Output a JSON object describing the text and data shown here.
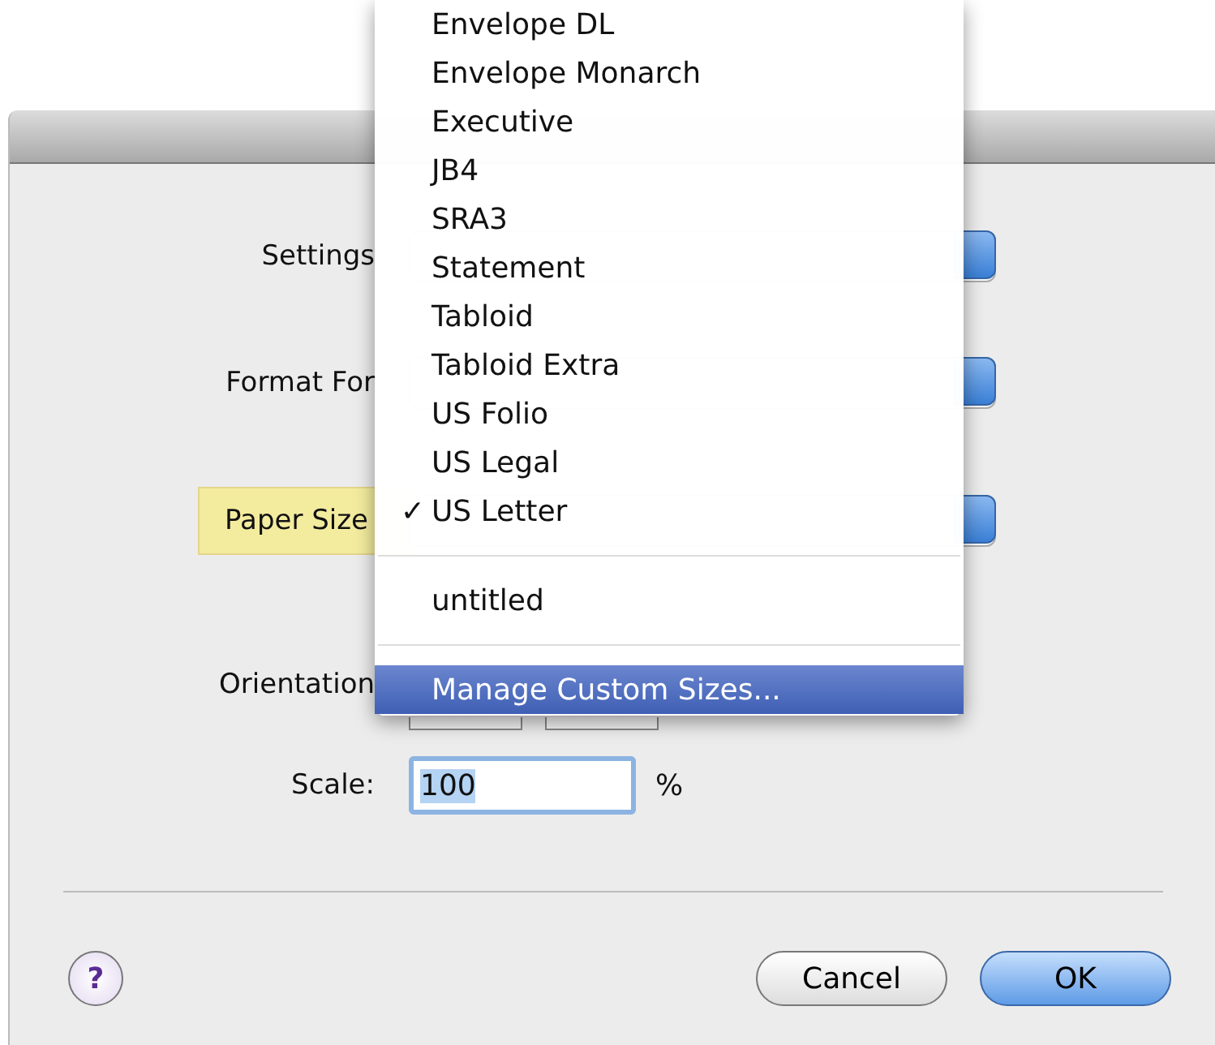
{
  "dialog": {
    "rows": [
      {
        "kind": "popup",
        "label": "Settings",
        "highlighted": false
      },
      {
        "kind": "popup",
        "label": "Format For",
        "highlighted": false
      },
      {
        "kind": "popup",
        "label": "Paper Size",
        "highlighted": true
      },
      {
        "kind": "orientation",
        "label": "Orientation",
        "highlighted": false
      },
      {
        "kind": "field",
        "label": "Scale:",
        "value": "100",
        "unit": "%",
        "highlighted": false
      }
    ],
    "help_button": "?",
    "buttons": [
      {
        "label": "Cancel",
        "default": false
      },
      {
        "label": "OK",
        "default": true
      }
    ]
  },
  "menu": {
    "check_mark": "✓",
    "items": [
      {
        "kind": "option",
        "label": "Envelope DL",
        "checked": false,
        "highlighted": false
      },
      {
        "kind": "option",
        "label": "Envelope Monarch",
        "checked": false,
        "highlighted": false
      },
      {
        "kind": "option",
        "label": "Executive",
        "checked": false,
        "highlighted": false
      },
      {
        "kind": "option",
        "label": "JB4",
        "checked": false,
        "highlighted": false
      },
      {
        "kind": "option",
        "label": "SRA3",
        "checked": false,
        "highlighted": false
      },
      {
        "kind": "option",
        "label": "Statement",
        "checked": false,
        "highlighted": false
      },
      {
        "kind": "option",
        "label": "Tabloid",
        "checked": false,
        "highlighted": false
      },
      {
        "kind": "option",
        "label": "Tabloid Extra",
        "checked": false,
        "highlighted": false
      },
      {
        "kind": "option",
        "label": "US Folio",
        "checked": false,
        "highlighted": false
      },
      {
        "kind": "option",
        "label": "US Legal",
        "checked": false,
        "highlighted": false
      },
      {
        "kind": "option",
        "label": "US Letter",
        "checked": true,
        "highlighted": false
      },
      {
        "kind": "separator"
      },
      {
        "kind": "option",
        "label": "untitled",
        "checked": false,
        "highlighted": false
      },
      {
        "kind": "separator"
      },
      {
        "kind": "option",
        "label": "Manage Custom Sizes...",
        "checked": false,
        "highlighted": true
      }
    ]
  }
}
